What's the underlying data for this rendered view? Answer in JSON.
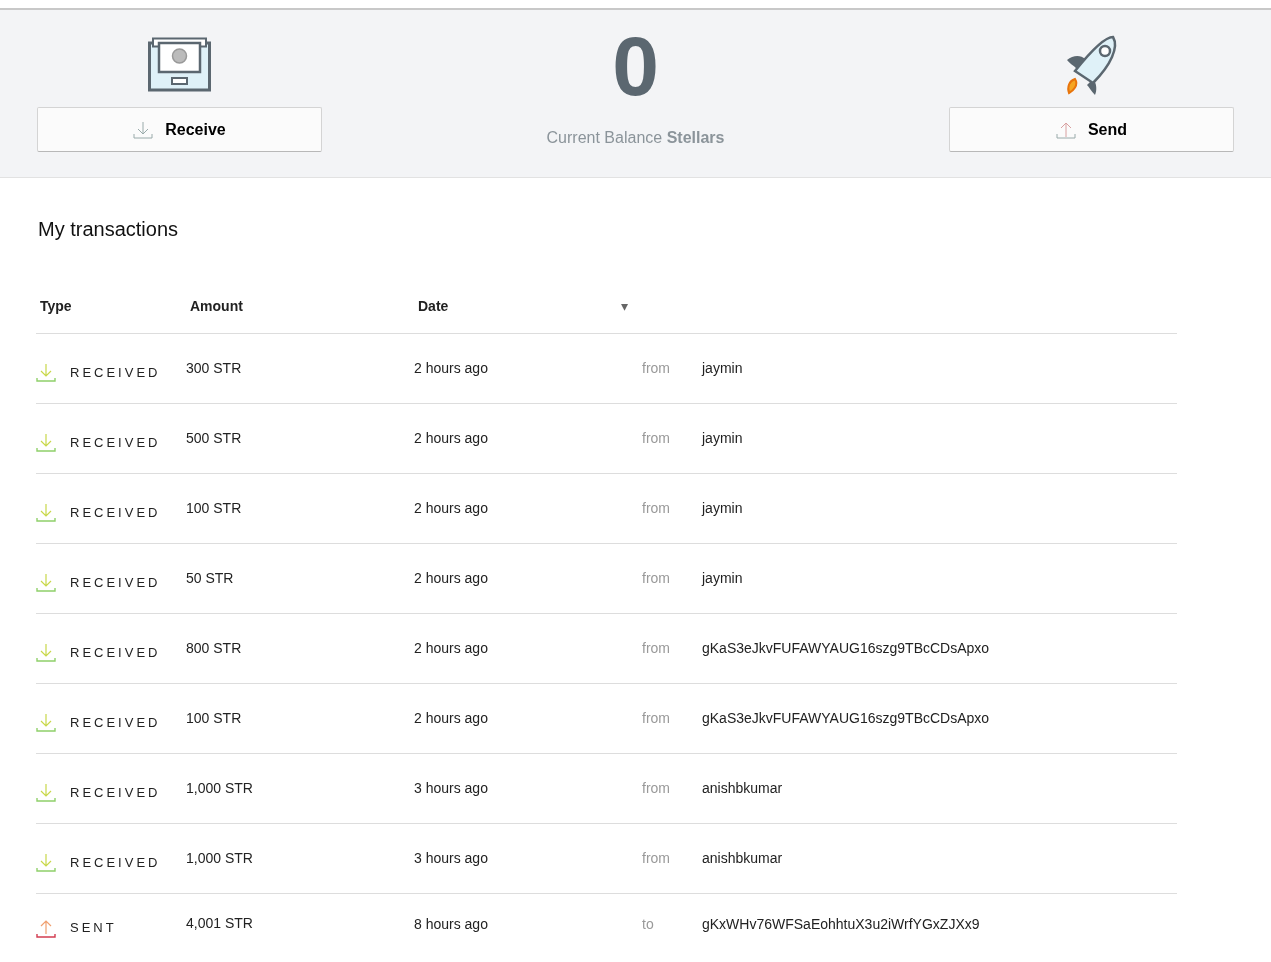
{
  "header": {
    "receive_button": "Receive",
    "balance": "0",
    "balance_label": "Current Balance **Stellars**",
    "send_button": "Send"
  },
  "transactions": {
    "title": "My transactions",
    "columns": [
      "Type",
      "Amount",
      "Date"
    ],
    "sort_indicator": "▾",
    "rows": [
      {
        "kind": "received",
        "type": "RECEIVED",
        "amount": "300 STR",
        "date": "2 hours ago",
        "direction": "from",
        "counterparty": "jaymin"
      },
      {
        "kind": "received",
        "type": "RECEIVED",
        "amount": "500 STR",
        "date": "2 hours ago",
        "direction": "from",
        "counterparty": "jaymin"
      },
      {
        "kind": "received",
        "type": "RECEIVED",
        "amount": "100 STR",
        "date": "2 hours ago",
        "direction": "from",
        "counterparty": "jaymin"
      },
      {
        "kind": "received",
        "type": "RECEIVED",
        "amount": "50 STR",
        "date": "2 hours ago",
        "direction": "from",
        "counterparty": "jaymin"
      },
      {
        "kind": "received",
        "type": "RECEIVED",
        "amount": "800 STR",
        "date": "2 hours ago",
        "direction": "from",
        "counterparty": "gKaS3eJkvFUFAWYAUG16szg9TBcCDsApxo"
      },
      {
        "kind": "received",
        "type": "RECEIVED",
        "amount": "100 STR",
        "date": "2 hours ago",
        "direction": "from",
        "counterparty": "gKaS3eJkvFUFAWYAUG16szg9TBcCDsApxo"
      },
      {
        "kind": "received",
        "type": "RECEIVED",
        "amount": "1,000 STR",
        "date": "3 hours ago",
        "direction": "from",
        "counterparty": "anishbkumar"
      },
      {
        "kind": "received",
        "type": "RECEIVED",
        "amount": "1,000 STR",
        "date": "3 hours ago",
        "direction": "from",
        "counterparty": "anishbkumar"
      },
      {
        "kind": "sent",
        "type": "SENT",
        "amount": "4,001 STR",
        "date": "8 hours ago",
        "direction": "to",
        "counterparty": "gKxWHv76WFSaEohhtuX3u2iWrfYGxZJXx9"
      }
    ]
  }
}
